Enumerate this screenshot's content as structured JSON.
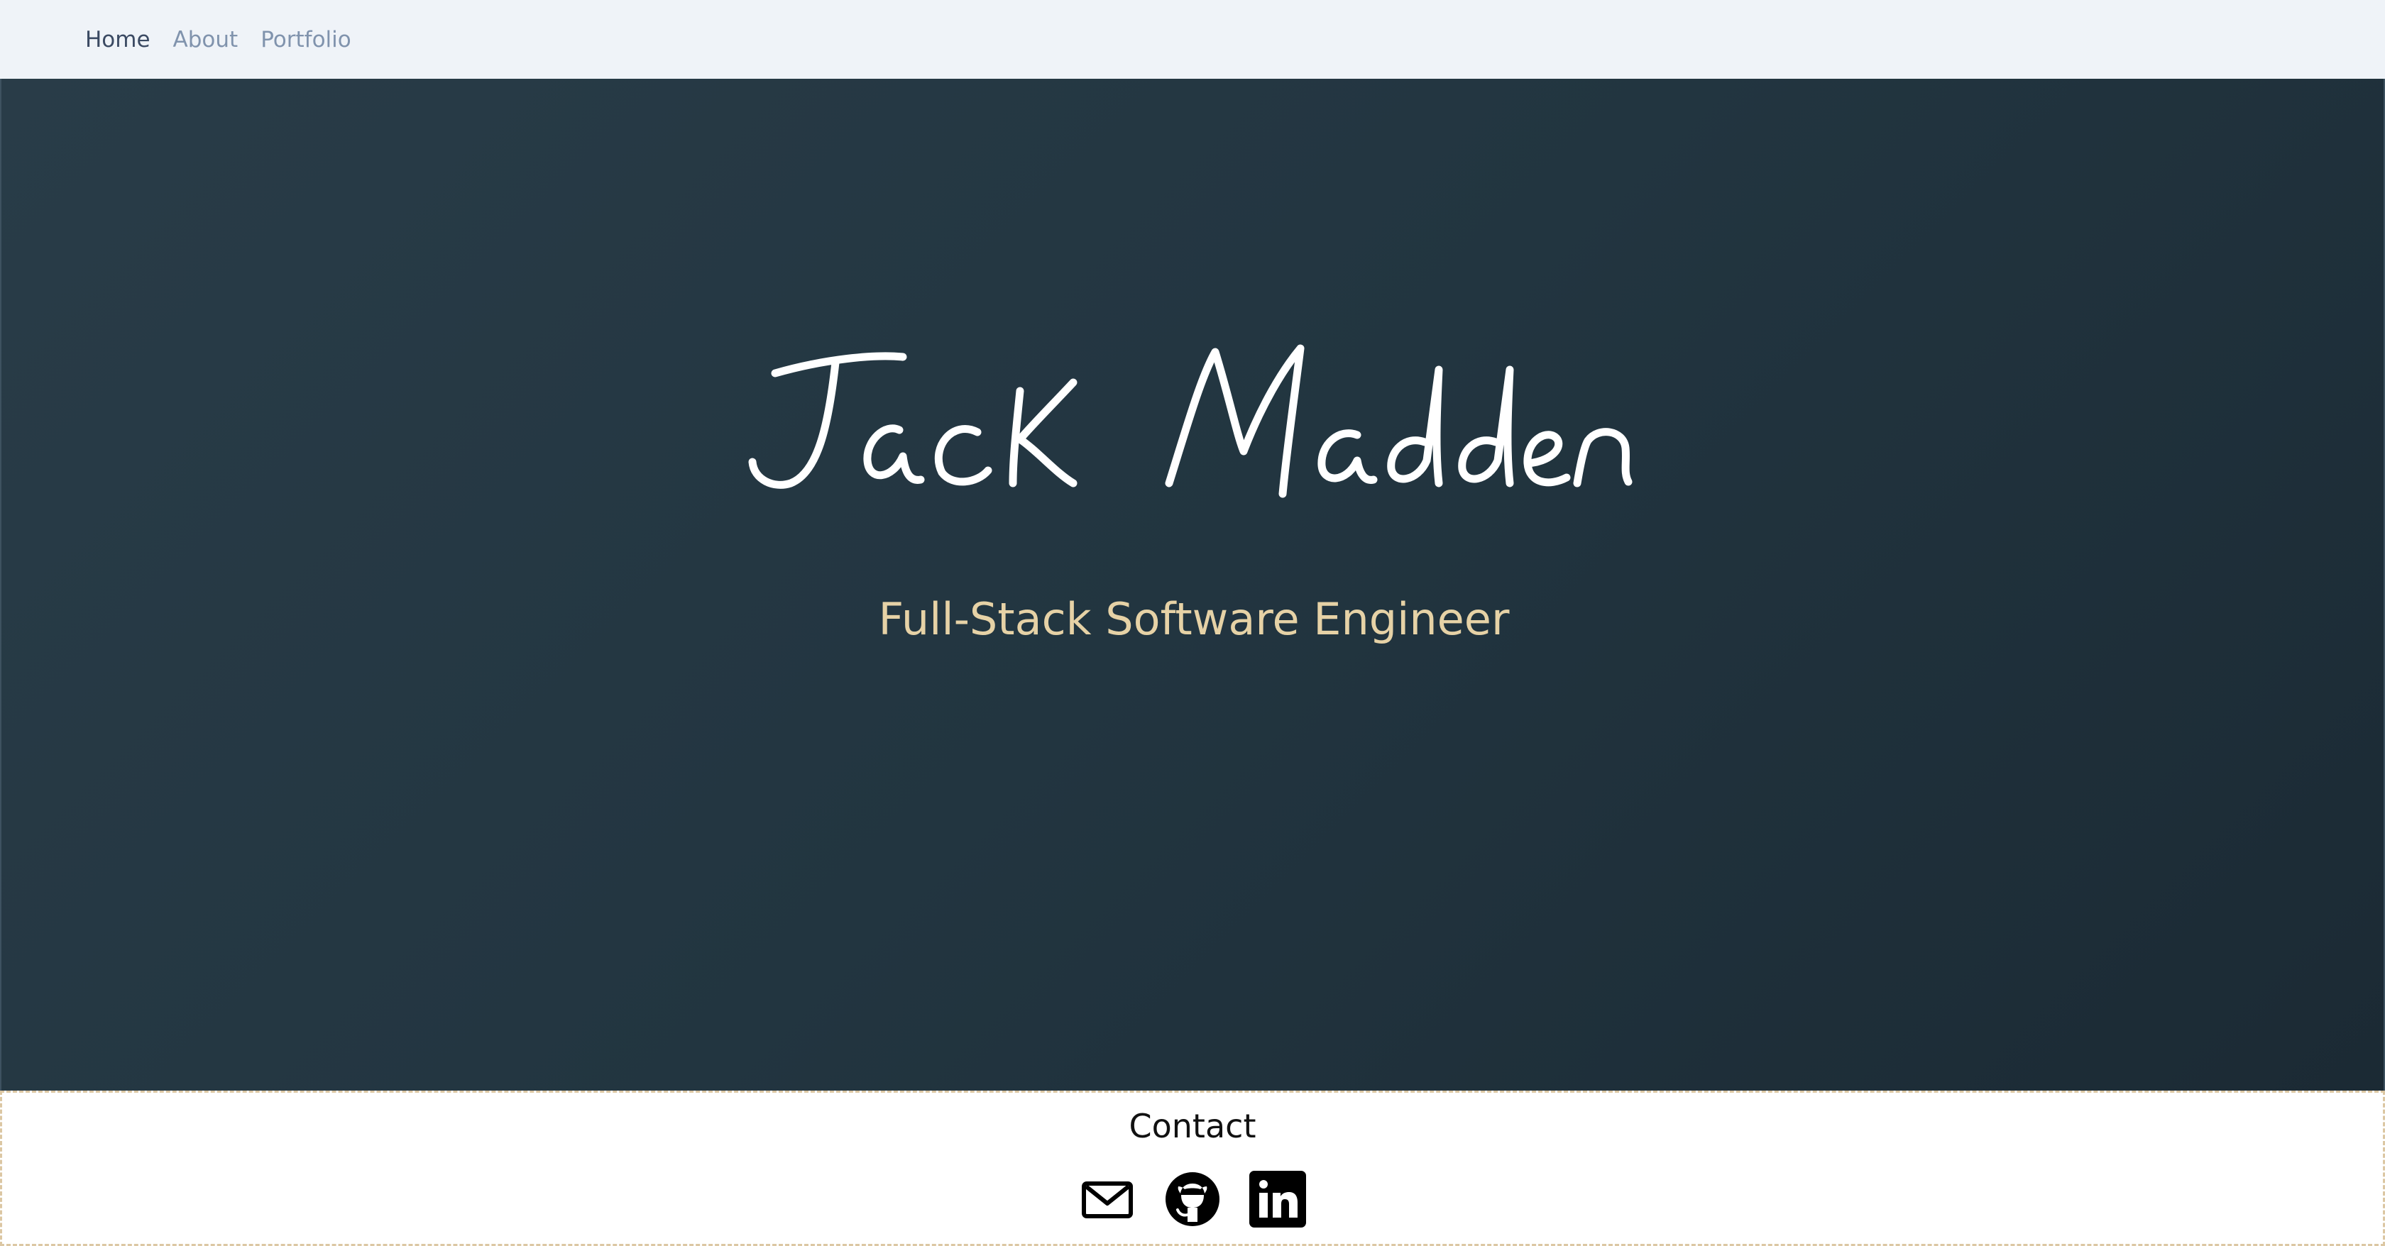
{
  "nav": {
    "items": [
      {
        "label": "Home",
        "active": true
      },
      {
        "label": "About",
        "active": false
      },
      {
        "label": "Portfolio",
        "active": false
      }
    ]
  },
  "hero": {
    "name": "Jack Madden",
    "subtitle": "Full-Stack Software Engineer"
  },
  "contact": {
    "title": "Contact",
    "icons": [
      "mail-icon",
      "github-icon",
      "linkedin-icon"
    ]
  },
  "colors": {
    "nav_bg": "#eff3f8",
    "nav_active": "#3b4a63",
    "nav_inactive": "#8093ad",
    "hero_bg": "#243742",
    "subtitle": "#e6d2a6",
    "name": "#ffffff"
  }
}
